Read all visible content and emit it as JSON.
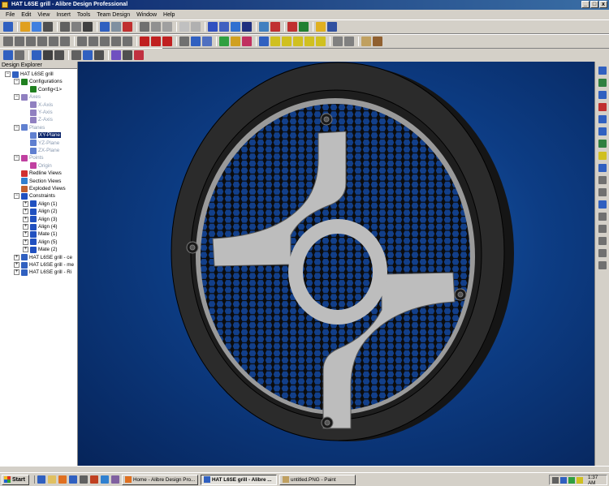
{
  "window": {
    "title": "HAT L6SE grill - Alibre Design Professional",
    "controls": [
      "_",
      "□",
      "x"
    ]
  },
  "menu": [
    "File",
    "Edit",
    "View",
    "Insert",
    "Tools",
    "Team Design",
    "Window",
    "Help"
  ],
  "explorer": {
    "header": "Design Explorer",
    "tree": [
      {
        "label": "HAT L6SE grill",
        "expander": "−",
        "icon": "part-icon",
        "color": "#3060c0",
        "indent": 0,
        "dim": false
      },
      {
        "label": "Configurations",
        "expander": "−",
        "icon": "configurations-icon",
        "color": "#208020",
        "indent": 1,
        "dim": false
      },
      {
        "label": "Config<1>",
        "expander": "",
        "icon": "config-icon",
        "color": "#208020",
        "indent": 2,
        "dim": false
      },
      {
        "label": "Axes",
        "expander": "−",
        "icon": "axes-icon",
        "color": "#9080c0",
        "indent": 1,
        "dim": true
      },
      {
        "label": "X-Axis",
        "expander": "",
        "icon": "axis-icon",
        "color": "#9080c0",
        "indent": 2,
        "dim": true
      },
      {
        "label": "Y-Axis",
        "expander": "",
        "icon": "axis-icon",
        "color": "#9080c0",
        "indent": 2,
        "dim": true
      },
      {
        "label": "Z-Axis",
        "expander": "",
        "icon": "axis-icon",
        "color": "#9080c0",
        "indent": 2,
        "dim": true
      },
      {
        "label": "Planes",
        "expander": "−",
        "icon": "planes-icon",
        "color": "#6080d0",
        "indent": 1,
        "dim": true
      },
      {
        "label": "XY-Plane",
        "expander": "",
        "icon": "plane-icon",
        "color": "#6080d0",
        "indent": 2,
        "dim": false,
        "selected": true
      },
      {
        "label": "YZ-Plane",
        "expander": "",
        "icon": "plane-icon",
        "color": "#6080d0",
        "indent": 2,
        "dim": true
      },
      {
        "label": "ZX-Plane",
        "expander": "",
        "icon": "plane-icon",
        "color": "#6080d0",
        "indent": 2,
        "dim": true
      },
      {
        "label": "Points",
        "expander": "−",
        "icon": "points-icon",
        "color": "#c040a0",
        "indent": 1,
        "dim": true
      },
      {
        "label": "Origin",
        "expander": "",
        "icon": "origin-icon",
        "color": "#c040a0",
        "indent": 2,
        "dim": true
      },
      {
        "label": "Redline Views",
        "expander": "",
        "icon": "redline-views-icon",
        "color": "#d03030",
        "indent": 1,
        "dim": false
      },
      {
        "label": "Section Views",
        "expander": "",
        "icon": "section-views-icon",
        "color": "#3080d0",
        "indent": 1,
        "dim": false
      },
      {
        "label": "Exploded Views",
        "expander": "",
        "icon": "exploded-views-icon",
        "color": "#c06030",
        "indent": 1,
        "dim": false
      },
      {
        "label": "Constraints",
        "expander": "−",
        "icon": "constraints-icon",
        "color": "#2050c0",
        "indent": 1,
        "dim": false
      },
      {
        "label": "Align (1)",
        "expander": "+",
        "icon": "align-icon",
        "color": "#2050c0",
        "indent": 2,
        "dim": false
      },
      {
        "label": "Align (2)",
        "expander": "+",
        "icon": "align-icon",
        "color": "#2050c0",
        "indent": 2,
        "dim": false
      },
      {
        "label": "Align (3)",
        "expander": "+",
        "icon": "align-icon",
        "color": "#2050c0",
        "indent": 2,
        "dim": false
      },
      {
        "label": "Align (4)",
        "expander": "+",
        "icon": "align-icon",
        "color": "#2050c0",
        "indent": 2,
        "dim": false
      },
      {
        "label": "Mate (1)",
        "expander": "+",
        "icon": "mate-icon",
        "color": "#2050c0",
        "indent": 2,
        "dim": false
      },
      {
        "label": "Align (5)",
        "expander": "+",
        "icon": "align-icon",
        "color": "#2050c0",
        "indent": 2,
        "dim": false
      },
      {
        "label": "Mate (2)",
        "expander": "+",
        "icon": "mate-icon",
        "color": "#2050c0",
        "indent": 2,
        "dim": false
      },
      {
        "label": "HAT L6SE grill - ce",
        "expander": "+",
        "icon": "subpart-icon",
        "color": "#3060c0",
        "indent": 1,
        "dim": false
      },
      {
        "label": "HAT L6SE grill - me",
        "expander": "+",
        "icon": "subpart-icon",
        "color": "#3060c0",
        "indent": 1,
        "dim": false
      },
      {
        "label": "HAT L6SE grill - Ri",
        "expander": "+",
        "icon": "subpart-icon",
        "color": "#3060c0",
        "indent": 1,
        "dim": false
      }
    ]
  },
  "toolbar_colors": {
    "row1": [
      "#3060c0",
      "#e0a020",
      "#4080e0",
      "#505050",
      "#606060",
      "#808080",
      "#404040",
      "#3060c0",
      "#8090a0",
      "#c03030",
      "#707070",
      "#909090",
      "#a0a0a0",
      "#c0c0c0",
      "#b0b0b0",
      "#3050c0",
      "#4060c0",
      "#3070d0",
      "#203080",
      "#4080c0",
      "#c03030",
      "#c03030",
      "#208030",
      "#e0b020",
      "#3050a0"
    ],
    "row2": [
      "#707070",
      "#707070",
      "#707070",
      "#707070",
      "#707070",
      "#707070",
      "#707070",
      "#707070",
      "#707070",
      "#707070",
      "#707070",
      "#c02020",
      "#c02020",
      "#c02020",
      "#707070",
      "#3060c0",
      "#5070c0",
      "#30a040",
      "#d0a020",
      "#c03060",
      "#3060c0",
      "#d0c020",
      "#d0c020",
      "#d0c020",
      "#d0c020",
      "#d0c020",
      "#808080",
      "#808080",
      "#c0a060",
      "#906030"
    ],
    "row3": [
      "#3060c0",
      "#707070",
      "#3060c0",
      "#404040",
      "#505050",
      "#606060",
      "#3060c0",
      "#505050",
      "#7050c0",
      "#505050",
      "#c03040"
    ]
  },
  "right_toolbar_colors": [
    "#3060c0",
    "#308040",
    "#3060c0",
    "#c03030",
    "#3060c0",
    "#3060c0",
    "#308040",
    "#d0c020",
    "#3060c0",
    "#707070",
    "#707070",
    "#3060c0",
    "#707070",
    "#707070",
    "#707070",
    "#707070",
    "#707070"
  ],
  "taskbar": {
    "start_label": "Start",
    "quicklaunch_colors": [
      "#3060c0",
      "#e0c060",
      "#e07020",
      "#3060c0",
      "#606060",
      "#c04020",
      "#3080d0",
      "#8060a0"
    ],
    "tasks": [
      {
        "label": "Home - Alibre Design Pro...",
        "active": false,
        "icon": "browser-icon",
        "color": "#e07020"
      },
      {
        "label": "HAT L6SE grill - Alibre ...",
        "active": true,
        "icon": "alibre-icon",
        "color": "#3060c0"
      },
      {
        "label": "untitled.PNG - Paint",
        "active": false,
        "icon": "paint-icon",
        "color": "#c0a060"
      }
    ],
    "clock": "1:37 AM"
  }
}
